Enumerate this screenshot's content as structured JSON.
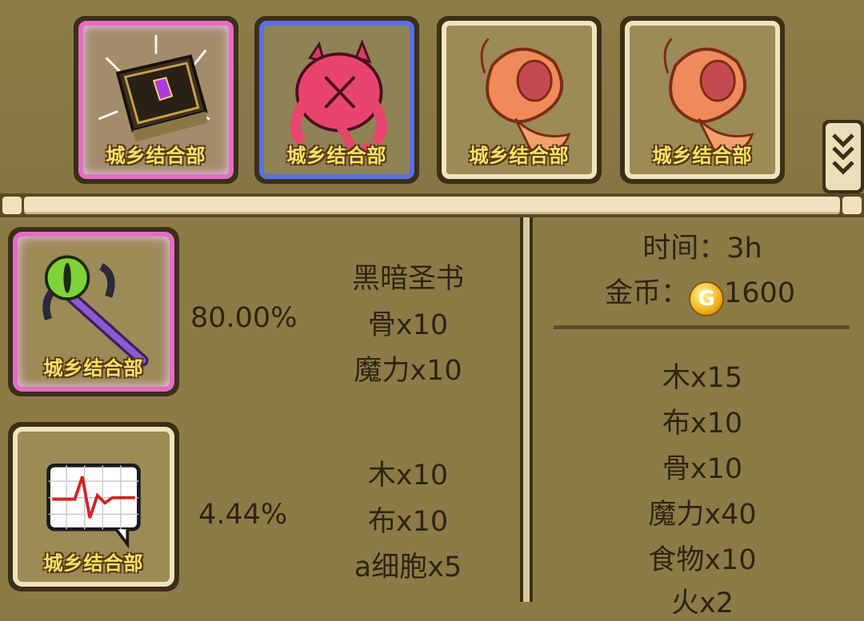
{
  "top_slots": [
    {
      "name": "dark-holy-book",
      "watermark": "城乡结合部",
      "rarity_color": "#e36dc4"
    },
    {
      "name": "red-fruit-creature",
      "watermark": "城乡结合部",
      "rarity_color": "#5a6fe8"
    },
    {
      "name": "shrimp",
      "watermark": "城乡结合部",
      "rarity_color": "#f0e4bb"
    },
    {
      "name": "shrimp",
      "watermark": "城乡结合部",
      "rarity_color": "#f0e4bb"
    }
  ],
  "recipes": [
    {
      "icon": "eye-staff-icon",
      "watermark": "城乡结合部",
      "chance": "80.00%",
      "lines": [
        "黑暗圣书",
        "骨x10",
        "魔力x10"
      ]
    },
    {
      "icon": "heartbeat-monitor-icon",
      "watermark": "城乡结合部",
      "chance": "4.44%",
      "lines": [
        "木x10",
        "布x10",
        "a细胞x5"
      ]
    }
  ],
  "cost": {
    "time_label": "时间：3h",
    "gold_label": "金币：",
    "gold_value": "1600",
    "materials": [
      "木x15",
      "布x10",
      "骨x10",
      "魔力x40",
      "食物x10",
      "火x2"
    ]
  }
}
